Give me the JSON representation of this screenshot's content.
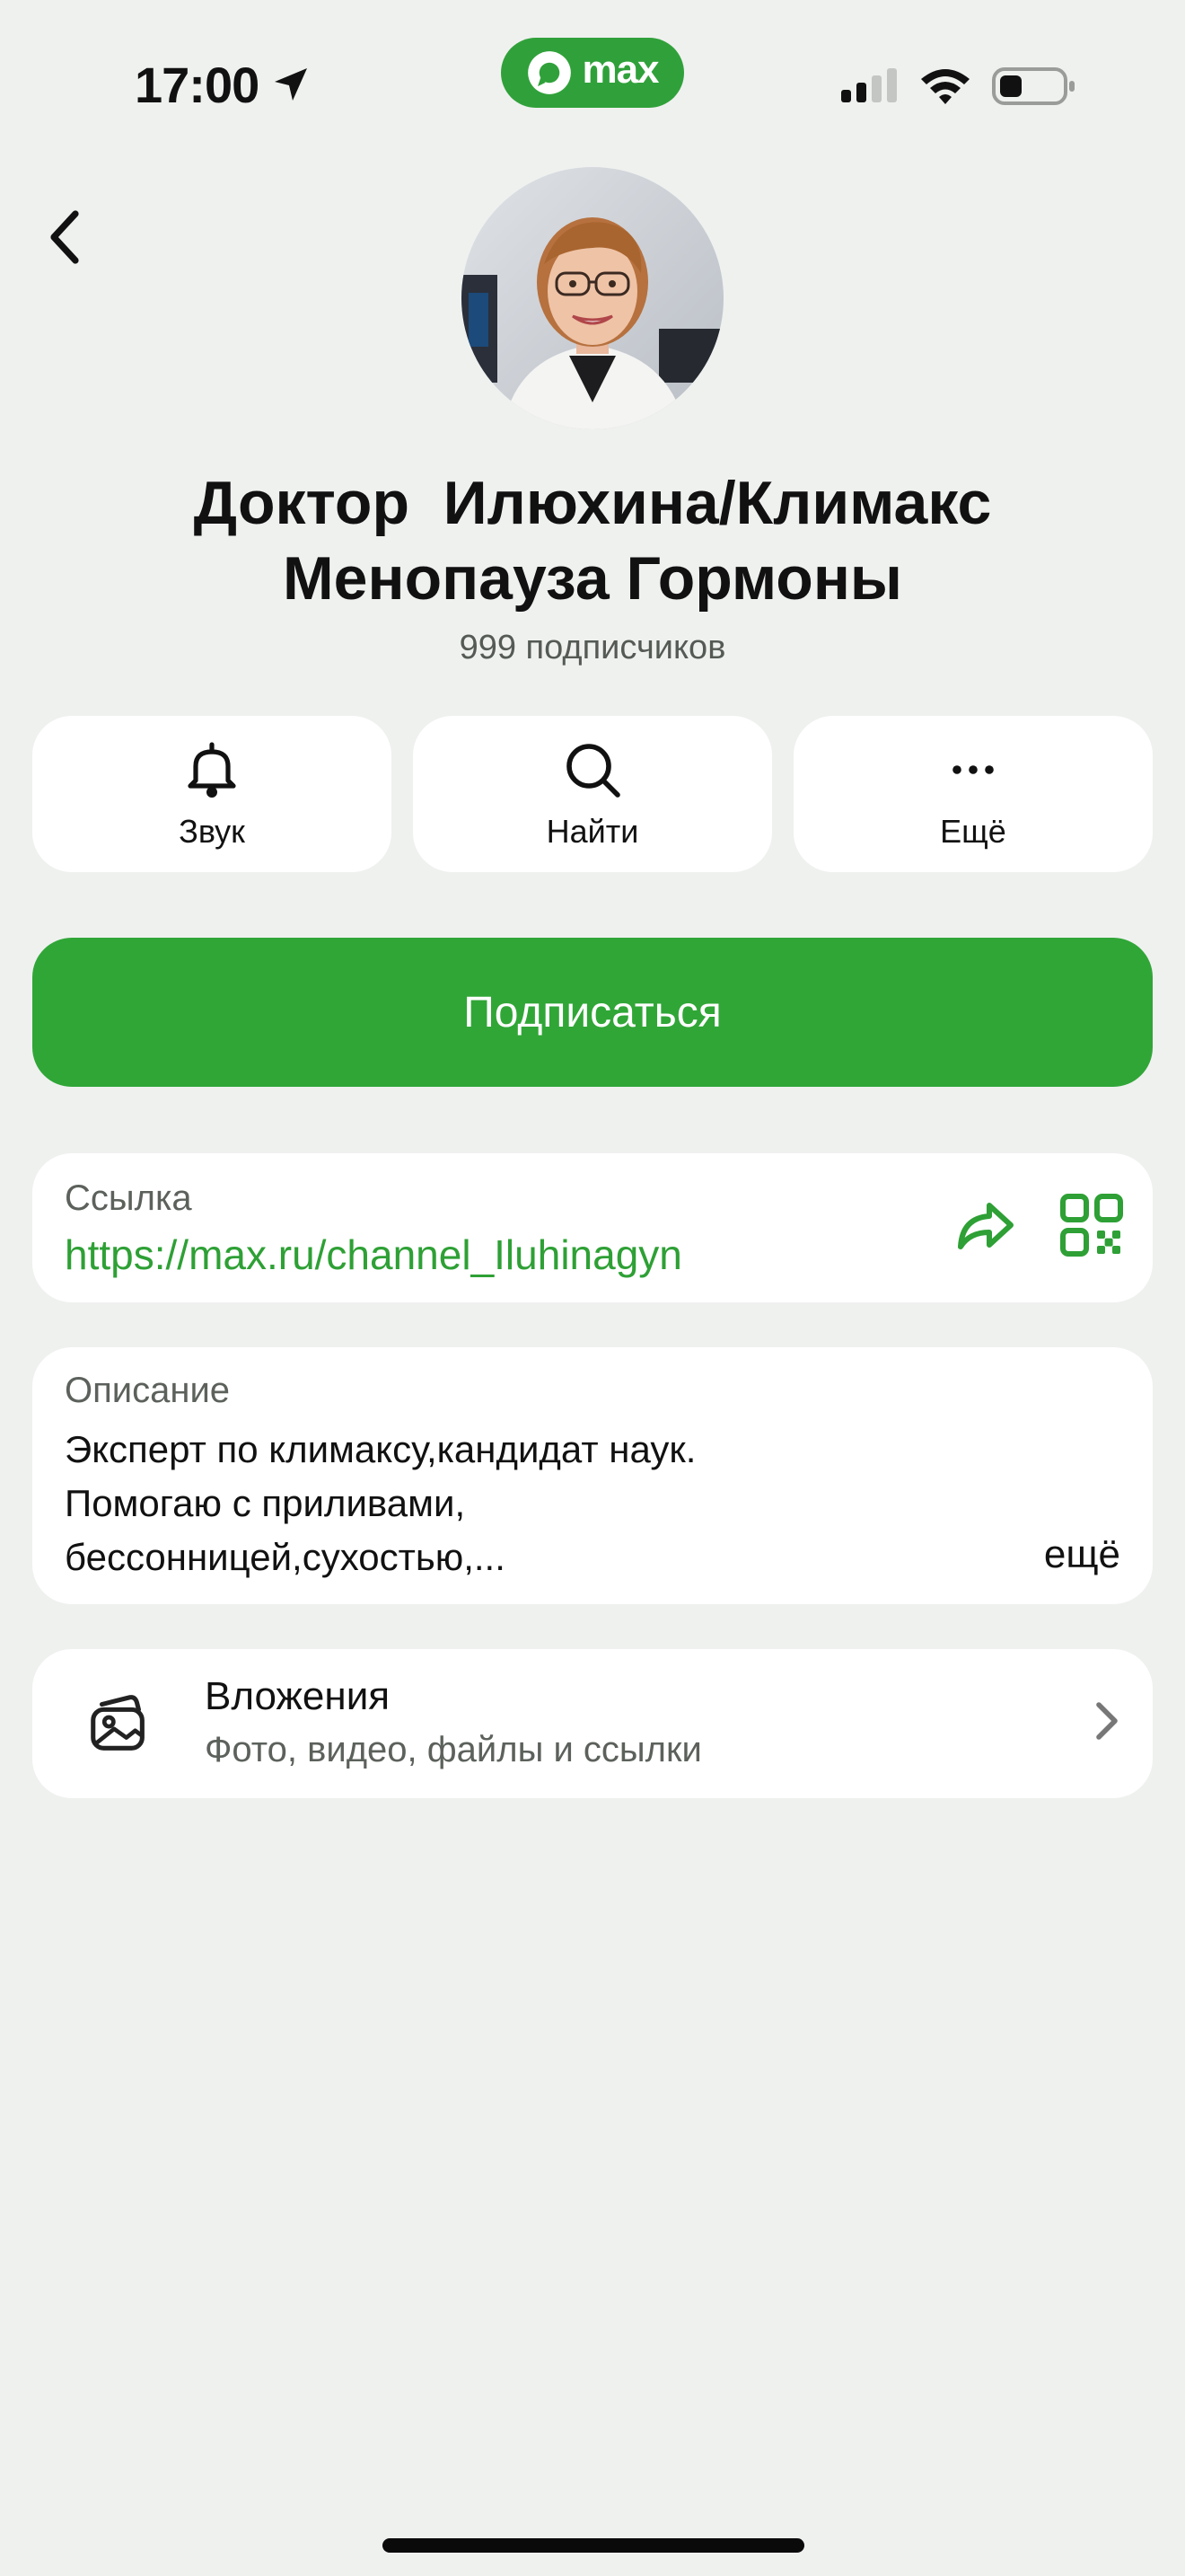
{
  "status_bar": {
    "time": "17:00",
    "app_badge": "max",
    "icons": [
      "location-arrow-icon",
      "max-logo-icon",
      "cellular-signal-icon",
      "wifi-icon",
      "battery-icon"
    ]
  },
  "header": {
    "back_icon": "chevron-left-icon",
    "title": "Доктор  Илюхина/Климакс\nМенопауза Гормоны",
    "subscribers": "999 подписчиков"
  },
  "actions": [
    {
      "label": "Звук",
      "icon": "bell-icon"
    },
    {
      "label": "Найти",
      "icon": "search-icon"
    },
    {
      "label": "Ещё",
      "icon": "more-dots-icon"
    }
  ],
  "subscribe": {
    "label": "Подписаться"
  },
  "link": {
    "caption": "Ссылка",
    "url": "https://max.ru/channel_Iluhinagyn",
    "icons": [
      "share-icon",
      "qr-code-icon"
    ]
  },
  "description": {
    "caption": "Описание",
    "text": "Эксперт по климаксу,кандидат наук.\nПомогаю с приливами,\nбессонницей,сухостью,...",
    "more": "ещё"
  },
  "attachments": {
    "title": "Вложения",
    "subtitle": "Фото, видео, файлы и ссылки",
    "icon": "gallery-icon"
  },
  "colors": {
    "accent": "#30a637",
    "background": "#eff1ef",
    "card": "#ffffff",
    "link": "#2ea035"
  }
}
